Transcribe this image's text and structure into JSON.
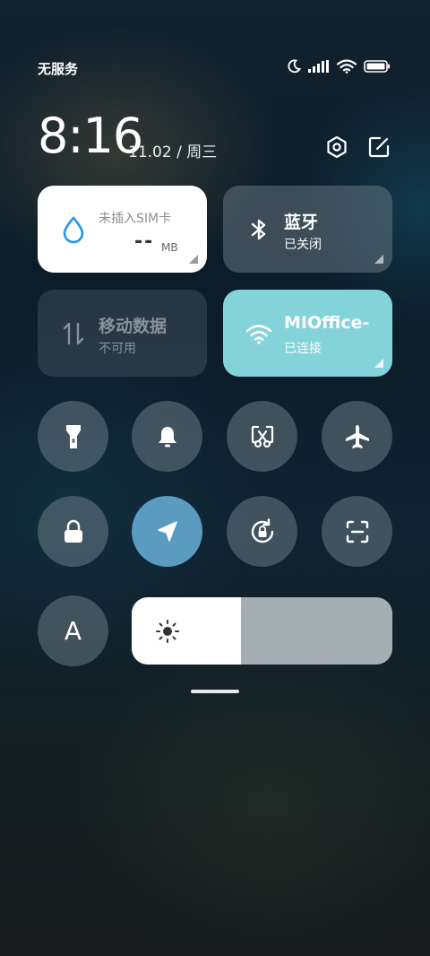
{
  "status_bar": {
    "carrier": "无服务",
    "icons": [
      "moon-icon",
      "signal-icon",
      "wifi-icon",
      "battery-icon"
    ]
  },
  "header": {
    "time": "8:16",
    "date": "11.02 / 周三",
    "actions": [
      "settings-icon",
      "edit-icon"
    ]
  },
  "tiles": {
    "sim": {
      "title": "未插入SIM卡",
      "value": "--",
      "unit": "MB",
      "icon": "water-drop-icon",
      "accent": "#2196f3"
    },
    "bluetooth": {
      "title": "蓝牙",
      "status": "已关闭",
      "icon": "bluetooth-icon"
    },
    "mobile_data": {
      "title": "移动数据",
      "status": "不可用",
      "icon": "data-transfer-icon"
    },
    "wifi": {
      "title": "MIOffice-",
      "status": "已连接",
      "icon": "wifi-icon",
      "color": "#84d3d9"
    }
  },
  "toggles": [
    {
      "name": "flashlight",
      "icon": "flashlight-icon",
      "active": false
    },
    {
      "name": "ringer",
      "icon": "bell-icon",
      "active": false
    },
    {
      "name": "screenshot",
      "icon": "screenshot-scissors-icon",
      "active": false
    },
    {
      "name": "airplane",
      "icon": "airplane-icon",
      "active": false
    },
    {
      "name": "lock-screen",
      "icon": "lock-icon",
      "active": false
    },
    {
      "name": "location",
      "icon": "location-arrow-icon",
      "active": true
    },
    {
      "name": "rotation-lock",
      "icon": "rotation-lock-icon",
      "active": false
    },
    {
      "name": "scanner",
      "icon": "scan-icon",
      "active": false
    }
  ],
  "auto_brightness": {
    "label": "A"
  },
  "brightness": {
    "level_percent": 42,
    "icon": "sun-icon"
  },
  "colors": {
    "active_toggle": "#5a9bbf",
    "wifi_tile": "#84d3d9"
  }
}
